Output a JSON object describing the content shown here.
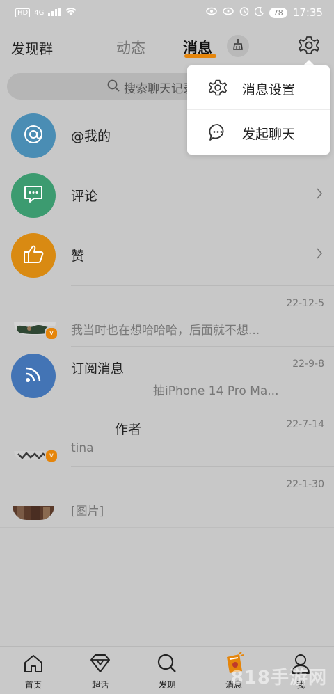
{
  "status_bar": {
    "left_indicators": [
      "HD",
      "4G"
    ],
    "battery": "78",
    "time": "17:35"
  },
  "header": {
    "left_title": "发现群",
    "tabs": [
      {
        "label": "动态",
        "active": false
      },
      {
        "label": "消息",
        "active": true
      }
    ],
    "accent_color": "#e5850b"
  },
  "search": {
    "placeholder": "搜索聊天记录"
  },
  "messages": [
    {
      "title": "@我的",
      "icon": "at-icon",
      "color": "#4a8db4"
    },
    {
      "title": "评论",
      "icon": "comment-icon",
      "color": "#3c9b70"
    },
    {
      "title": "赞",
      "icon": "thumbs-up-icon",
      "color": "#d98a12"
    },
    {
      "title": "",
      "preview": "我当时也在想哈哈哈，后面就不想...",
      "date": "22-12-5"
    },
    {
      "title": "订阅消息",
      "preview": "抽iPhone 14 Pro Ma...",
      "date": "22-9-8",
      "icon": "rss-icon",
      "color": "#4374b5"
    },
    {
      "title": "作者",
      "preview": "tina",
      "date": "22-7-14"
    },
    {
      "title": "",
      "preview": "[图片]",
      "date": "22-1-30"
    }
  ],
  "popup_menu": {
    "items": [
      {
        "label": "消息设置",
        "icon": "gear-icon"
      },
      {
        "label": "发起聊天",
        "icon": "chat-bubble-icon"
      }
    ]
  },
  "bottom_nav": {
    "items": [
      {
        "label": "首页",
        "icon": "home-icon"
      },
      {
        "label": "超话",
        "icon": "diamond-icon"
      },
      {
        "label": "发现",
        "icon": "search-icon"
      },
      {
        "label": "消息",
        "icon": "message-icon"
      },
      {
        "label": "我",
        "icon": "person-icon"
      }
    ]
  },
  "watermark": "818手游网"
}
